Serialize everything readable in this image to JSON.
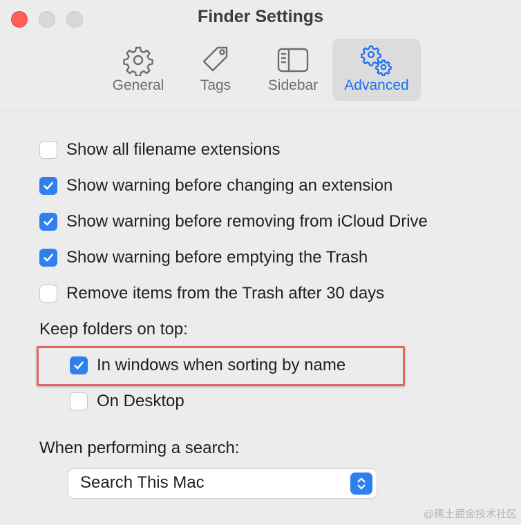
{
  "window": {
    "title": "Finder Settings"
  },
  "tabs": [
    {
      "label": "General",
      "icon": "gear-icon",
      "active": false
    },
    {
      "label": "Tags",
      "icon": "tag-icon",
      "active": false
    },
    {
      "label": "Sidebar",
      "icon": "sidebar-icon",
      "active": false
    },
    {
      "label": "Advanced",
      "icon": "gears-icon",
      "active": true
    }
  ],
  "options": [
    {
      "label": "Show all filename extensions",
      "checked": false
    },
    {
      "label": "Show warning before changing an extension",
      "checked": true
    },
    {
      "label": "Show warning before removing from iCloud Drive",
      "checked": true
    },
    {
      "label": "Show warning before emptying the Trash",
      "checked": true
    },
    {
      "label": "Remove items from the Trash after 30 days",
      "checked": false
    }
  ],
  "folders_on_top": {
    "heading": "Keep folders on top:",
    "items": [
      {
        "label": "In windows when sorting by name",
        "checked": true
      },
      {
        "label": "On Desktop",
        "checked": false
      }
    ]
  },
  "search": {
    "heading": "When performing a search:",
    "selected": "Search This Mac"
  },
  "watermark": "@稀土掘金技术社区",
  "colors": {
    "accent": "#2f80ed",
    "highlight_border": "#e4655f",
    "close_button": "#ff5f57"
  }
}
